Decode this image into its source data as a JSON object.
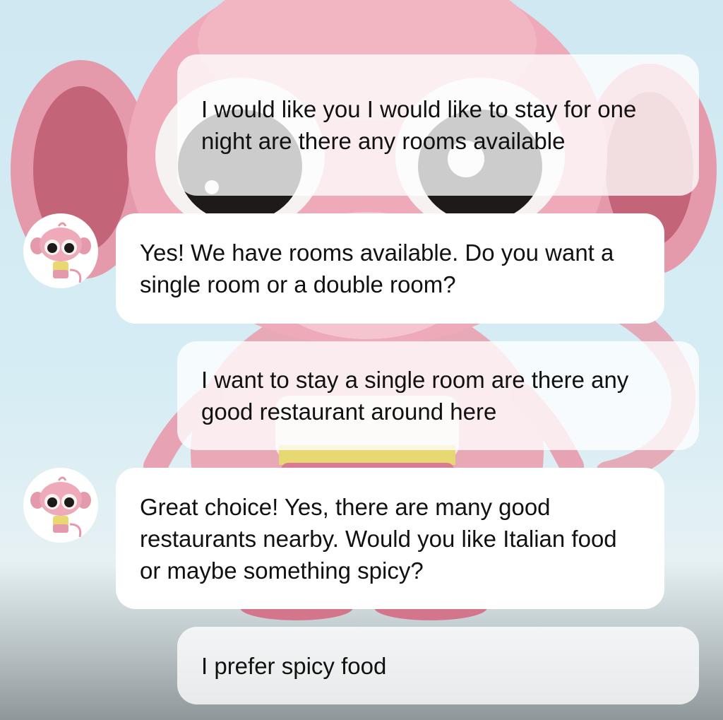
{
  "conversation": {
    "messages": [
      {
        "role": "user",
        "text": "I would like you I would like to stay for one night are there any rooms available"
      },
      {
        "role": "assistant",
        "text": "Yes! We have rooms available. Do you want a single room or a double room?"
      },
      {
        "role": "user",
        "text": "I want to stay a single room are there any good restaurant around here"
      },
      {
        "role": "assistant",
        "text": "Great choice! Yes, there are many good restaurants nearby. Would you like Italian food or maybe something spicy?"
      },
      {
        "role": "user",
        "text": "I prefer spicy food"
      }
    ]
  },
  "colors": {
    "monkey_pink": "#e9a5b4",
    "monkey_dark_pink": "#c96f83",
    "sky": "#cfe8f2",
    "bubble_bot": "#ffffff",
    "bubble_user": "rgba(255,255,255,0.78)"
  },
  "icons": {
    "avatar": "monkey-avatar-icon",
    "background_character": "monkey-character"
  }
}
